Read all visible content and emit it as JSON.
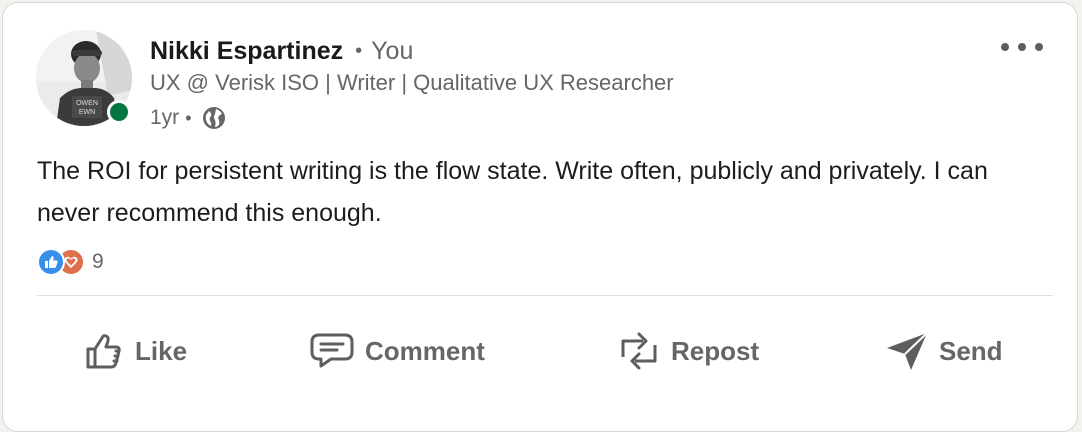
{
  "author": {
    "name": "Nikki Espartinez",
    "separator": "•",
    "degree": "You",
    "headline": "UX @ Verisk ISO | Writer | Qualitative UX Researcher",
    "time": "1yr",
    "time_separator": "•",
    "visibility_icon": "globe-icon",
    "presence": "online",
    "presence_color": "#057642",
    "avatar_shirt_text": "OWEN\nEWN"
  },
  "post": {
    "text": "The ROI for persistent writing is the flow state. Write often, publicly and privately. I can never recommend this enough."
  },
  "reactions": {
    "types": [
      "like",
      "love"
    ],
    "like_color": "#378fe9",
    "love_color": "#df704d",
    "count": "9"
  },
  "actions": {
    "like": "Like",
    "comment": "Comment",
    "repost": "Repost",
    "send": "Send"
  },
  "menu": {
    "icon": "more-horizontal-icon"
  }
}
